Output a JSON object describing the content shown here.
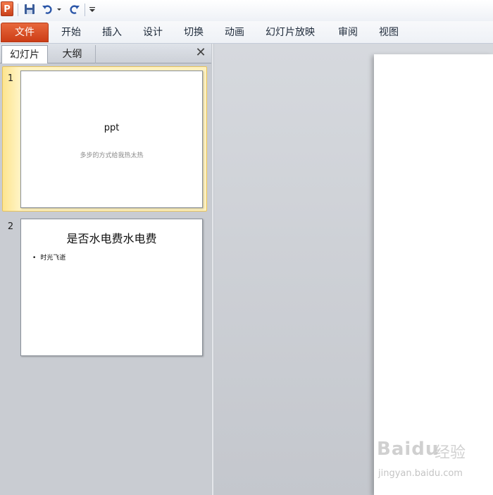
{
  "quick_access": {
    "app_icon_letter": "P",
    "icons": [
      "powerpoint-app-icon",
      "save-icon",
      "undo-icon",
      "undo-dropdown-icon",
      "redo-icon",
      "customize-toolbar-icon"
    ]
  },
  "ribbon": {
    "file_tab": "文件",
    "tabs": [
      "开始",
      "插入",
      "设计",
      "切换",
      "动画",
      "幻灯片放映",
      "审阅",
      "视图"
    ]
  },
  "left_pane": {
    "tabs": {
      "slides": "幻灯片",
      "outline": "大纲"
    },
    "close_glyph": "✕",
    "slides": [
      {
        "number": "1",
        "title": "ppt",
        "subtitle": "多步的方式给我热太热"
      },
      {
        "number": "2",
        "title": "是否水电费水电费",
        "bullet": "时光飞逝"
      }
    ]
  },
  "watermark": {
    "logo": "Bai",
    "logo_suffix": "du",
    "text": "经验",
    "url": "jingyan.baidu.com"
  },
  "colors": {
    "file_tab": "#d24a22",
    "selected_slide_highlight": "#fde58f",
    "workspace_bg": "#c9ccd2"
  }
}
